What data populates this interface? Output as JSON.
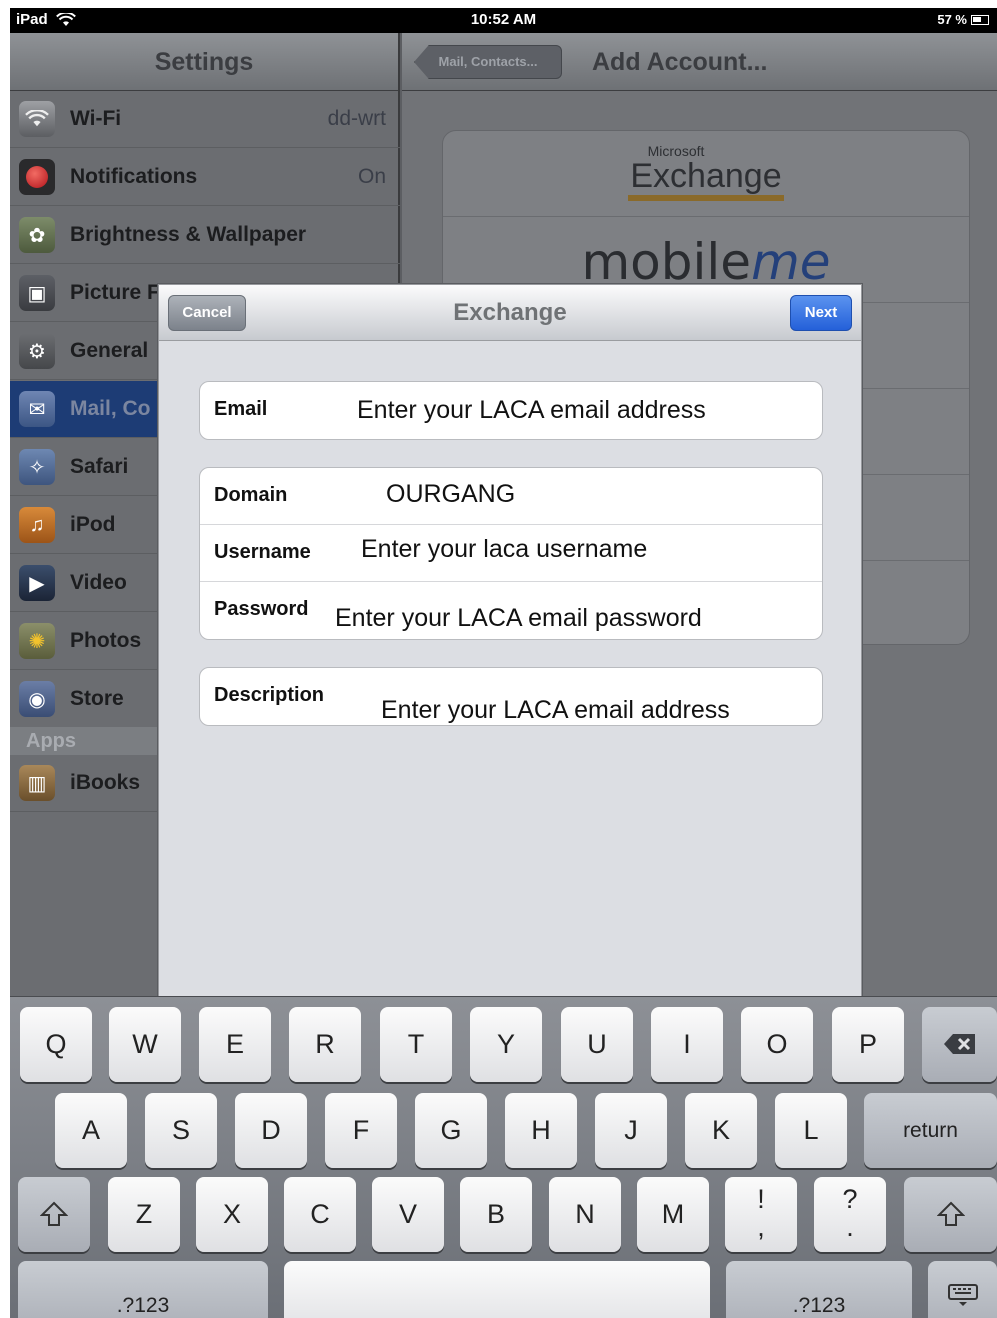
{
  "status_bar": {
    "device": "iPad",
    "time": "10:52 AM",
    "battery": "57 %"
  },
  "settings": {
    "title": "Settings",
    "items": [
      {
        "label": "Wi-Fi",
        "value": "dd-wrt",
        "icon": "wifi-icon"
      },
      {
        "label": "Notifications",
        "value": "On",
        "icon": "notifications-icon"
      },
      {
        "label": "Brightness & Wallpaper",
        "value": "",
        "icon": "brightness-icon"
      },
      {
        "label": "Picture F",
        "value": "",
        "icon": "picture-frame-icon"
      },
      {
        "label": "General",
        "value": "",
        "icon": "gear-icon"
      },
      {
        "label": "Mail, Co",
        "value": "",
        "icon": "mail-icon"
      },
      {
        "label": "Safari",
        "value": "",
        "icon": "safari-icon"
      },
      {
        "label": "iPod",
        "value": "",
        "icon": "ipod-icon"
      },
      {
        "label": "Video",
        "value": "",
        "icon": "video-icon"
      },
      {
        "label": "Photos",
        "value": "",
        "icon": "photos-icon"
      },
      {
        "label": "Store",
        "value": "",
        "icon": "store-icon"
      }
    ],
    "apps_header": "Apps",
    "apps": [
      {
        "label": "iBooks",
        "icon": "ibooks-icon"
      }
    ]
  },
  "detail": {
    "back_label": "Mail, Contacts...",
    "title": "Add Account...",
    "exchange_top": "Microsoft",
    "exchange_name": "Exchange",
    "mobileme_main": "mobile",
    "mobileme_me": "me"
  },
  "modal": {
    "title": "Exchange",
    "cancel_label": "Cancel",
    "next_label": "Next",
    "fields": {
      "email_label": "Email",
      "email_value": "Enter your LACA email address",
      "domain_label": "Domain",
      "domain_value": "OURGANG",
      "username_label": "Username",
      "username_value": "Enter your laca username",
      "password_label": "Password",
      "password_value": "Enter your LACA email password",
      "description_label": "Description",
      "description_value": "Enter your LACA email address"
    }
  },
  "keyboard": {
    "row1": [
      "Q",
      "W",
      "E",
      "R",
      "T",
      "Y",
      "U",
      "I",
      "O",
      "P"
    ],
    "row2": [
      "A",
      "S",
      "D",
      "F",
      "G",
      "H",
      "J",
      "K",
      "L"
    ],
    "return_label": "return",
    "row3": [
      "Z",
      "X",
      "C",
      "V",
      "B",
      "N",
      "M"
    ],
    "punct1_top": "!",
    "punct1_bottom": ",",
    "punct2_top": "?",
    "punct2_bottom": ".",
    "numbers_label": ".?123"
  }
}
